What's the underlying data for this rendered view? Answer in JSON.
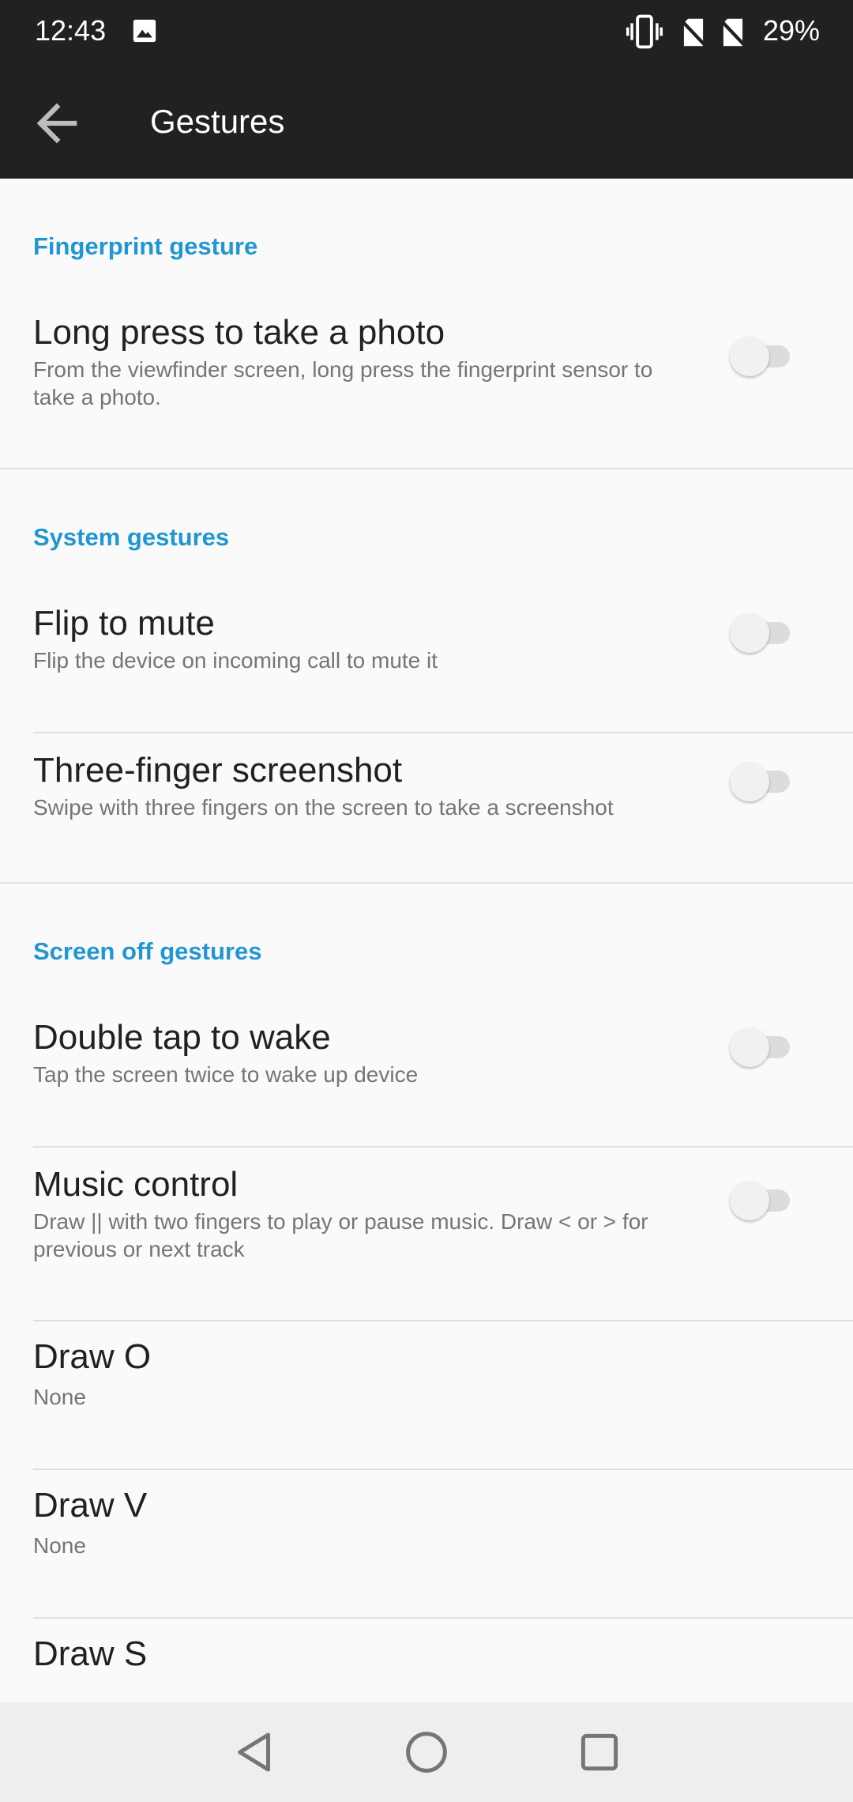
{
  "status_bar": {
    "time": "12:43",
    "battery": "29%",
    "icons": [
      "photo-icon",
      "vibrate-icon",
      "no-sim-icon",
      "no-sim-icon"
    ]
  },
  "toolbar": {
    "title": "Gestures",
    "back_icon": "arrow-back-icon"
  },
  "sections": {
    "fingerprint": {
      "header": "Fingerprint gesture",
      "items": [
        {
          "title": "Long press to take a photo",
          "subtitle": "From the viewfinder screen, long press the fingerprint sensor to take a photo.",
          "enabled": false
        }
      ]
    },
    "system": {
      "header": "System gestures",
      "items": [
        {
          "title": "Flip to mute",
          "subtitle": "Flip the device on incoming call to mute it",
          "enabled": false
        },
        {
          "title": "Three-finger screenshot",
          "subtitle": "Swipe with three fingers on the screen to take a screenshot",
          "enabled": false
        }
      ]
    },
    "screen_off": {
      "header": "Screen off gestures",
      "items": [
        {
          "title": "Double tap to wake",
          "subtitle": "Tap the screen twice to wake up device",
          "enabled": false
        },
        {
          "title": "Music control",
          "subtitle": "Draw || with two fingers to play or pause music. Draw < or > for previous or next track",
          "enabled": false
        },
        {
          "title": "Draw O",
          "subtitle": "None"
        },
        {
          "title": "Draw V",
          "subtitle": "None"
        },
        {
          "title": "Draw S",
          "subtitle": ""
        }
      ]
    }
  },
  "navigation_bar": {
    "buttons": [
      "back-triangle-icon",
      "home-circle-icon",
      "recents-square-icon"
    ]
  },
  "colors": {
    "accent": "#2196d3",
    "bar_background": "#212121",
    "page_background": "#fafafa"
  }
}
